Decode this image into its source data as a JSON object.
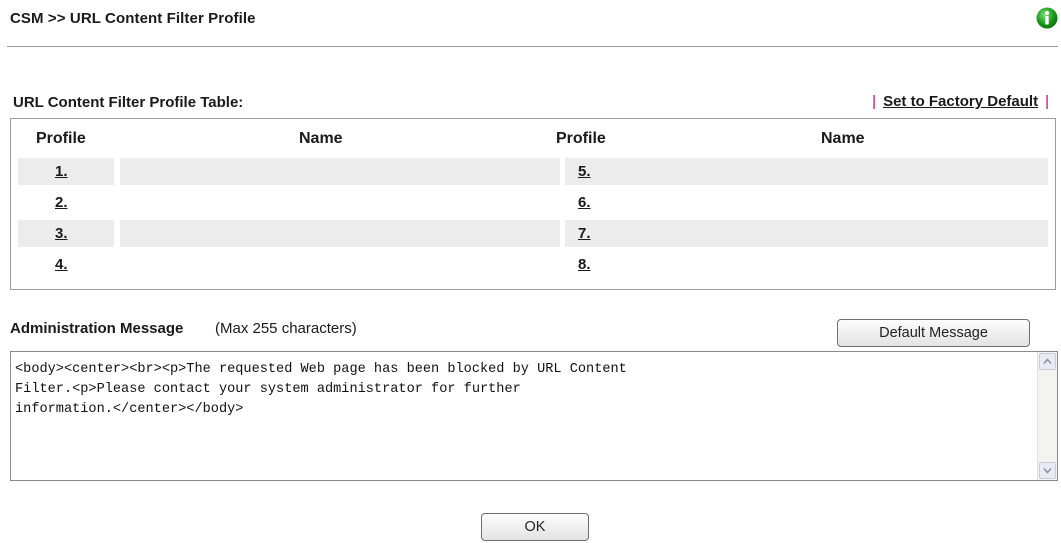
{
  "header": {
    "title": "CSM >> URL Content Filter Profile",
    "info_icon": "info-icon",
    "accent_color": "#1b9a1b"
  },
  "profile_table": {
    "caption": "URL Content Filter Profile Table:",
    "factory_link": "Set to Factory Default",
    "separator": "|",
    "columns": [
      "Profile",
      "Name",
      "Profile",
      "Name"
    ],
    "rows": [
      {
        "left_num": "1.",
        "left_name": "",
        "right_num": "5.",
        "right_name": ""
      },
      {
        "left_num": "2.",
        "left_name": "",
        "right_num": "6.",
        "right_name": ""
      },
      {
        "left_num": "3.",
        "left_name": "",
        "right_num": "7.",
        "right_name": ""
      },
      {
        "left_num": "4.",
        "left_name": "",
        "right_num": "8.",
        "right_name": ""
      }
    ]
  },
  "admin": {
    "label": "Administration Message",
    "hint": "(Max 255 characters)",
    "default_button": "Default Message",
    "message": "<body><center><br><p>The requested Web page has been blocked by URL Content\nFilter.<p>Please contact your system administrator for further\ninformation.</center></body>"
  },
  "footer": {
    "ok_button": "OK"
  }
}
